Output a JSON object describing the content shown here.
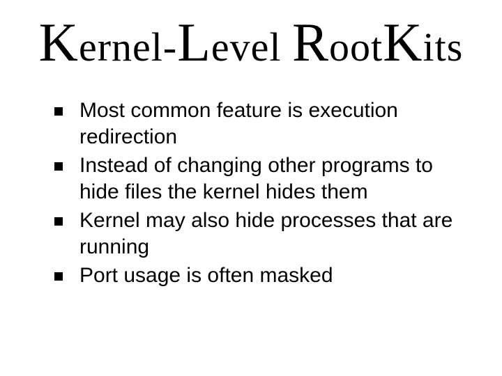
{
  "title_parts": {
    "p1_big": "K",
    "p1_rest": "ernel",
    "sep": "-",
    "p2_big": "L",
    "p2_rest": "evel ",
    "p3_big": "R",
    "p3_rest": "oot",
    "p4_big": "K",
    "p4_rest": "its"
  },
  "bullets": [
    "Most common feature is execution redirection",
    "Instead of changing other programs to hide files the kernel hides them",
    "Kernel may also hide processes that are running",
    "Port usage is often masked"
  ]
}
